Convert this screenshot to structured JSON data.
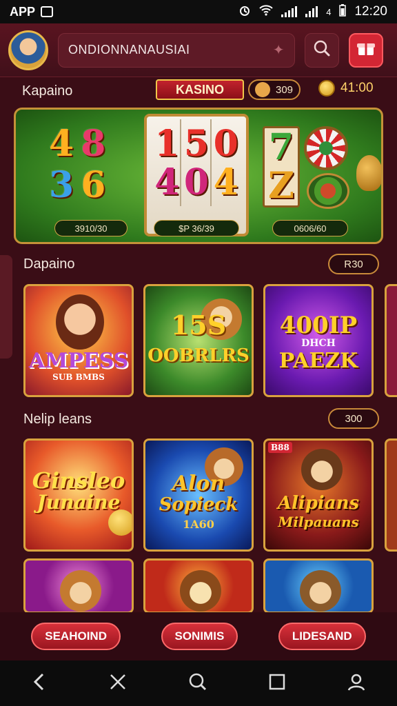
{
  "status_bar": {
    "app_label": "APP",
    "time": "12:20",
    "battery_level": "4"
  },
  "header": {
    "search_text": "ONDIONNANAUSIAI"
  },
  "top_row": {
    "section_title": "Kapaino",
    "banner_label": "KASINO",
    "coins_value": "309",
    "timer_value": "41:00"
  },
  "slot_panel": {
    "left_digits": [
      "4",
      "8",
      "3",
      "6"
    ],
    "center_digits": [
      "1",
      "5",
      "0",
      "4",
      "0",
      "4"
    ],
    "right_digits": [
      "7",
      "Z"
    ],
    "labels": [
      "3910/30",
      "$P 36/39",
      "0606/60"
    ]
  },
  "section1": {
    "title": "Dapaino",
    "pill": "R30",
    "cards": [
      {
        "title": "AMPESS",
        "subtitle": "SUB BMBS"
      },
      {
        "title": "15S",
        "subtitle": "OOBRLRS"
      },
      {
        "title": "400IP",
        "subtitle": "PAEZK"
      }
    ],
    "card3_small": "DHCH"
  },
  "section2": {
    "title": "Nelip leans",
    "pill": "300",
    "cards": [
      {
        "title": "Ginsleo",
        "subtitle": "Junaine"
      },
      {
        "title": "Alon",
        "subtitle": "Sopieck"
      },
      {
        "title": "Alipians",
        "subtitle": "Milpauans"
      }
    ],
    "card2_small": "1A60",
    "badge_b": "B88"
  },
  "bottom_tabs": [
    "SEAHOIND",
    "SONIMIS",
    "LIDESAND"
  ],
  "colors": {
    "accent": "#d32634",
    "gold": "#d9a23e",
    "background": "#3a0d16"
  }
}
